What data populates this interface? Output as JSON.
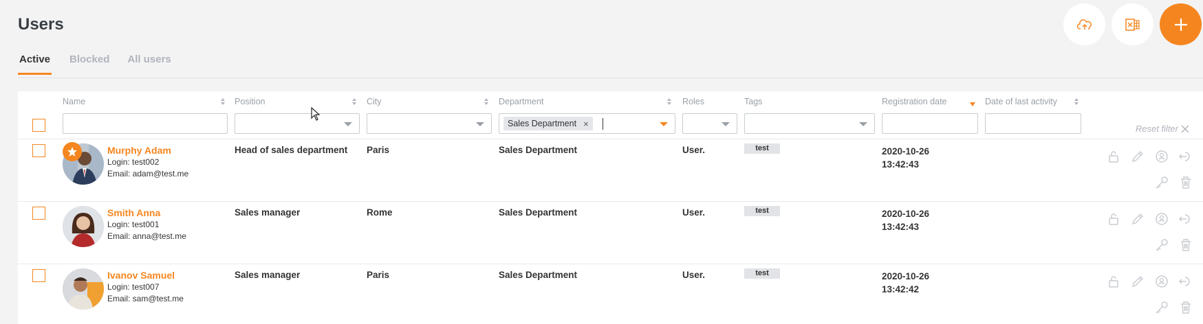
{
  "page": {
    "title": "Users"
  },
  "toolbar": {
    "upload_icon": "cloud-upload-icon",
    "excel_icon": "excel-export-icon",
    "add_icon": "plus-icon"
  },
  "tabs": [
    {
      "label": "Active",
      "active": true
    },
    {
      "label": "Blocked",
      "active": false
    },
    {
      "label": "All users",
      "active": false
    }
  ],
  "columns": {
    "name": "Name",
    "position": "Position",
    "city": "City",
    "department": "Department",
    "roles": "Roles",
    "tags": "Tags",
    "registration_date": "Registration date",
    "last_activity": "Date of last activity"
  },
  "filters": {
    "name_value": "",
    "position_value": "",
    "city_value": "",
    "department_chip": "Sales Department",
    "roles_value": "",
    "tags_value": "",
    "registration_value": "",
    "activity_value": "",
    "reset_label": "Reset filter"
  },
  "users": [
    {
      "name": "Murphy Adam",
      "login": "Login: test002",
      "email": "Email: adam@test.me",
      "position": "Head of sales department",
      "city": "Paris",
      "department": "Sales Department",
      "roles": "User.",
      "tag": "test",
      "reg_date": "2020-10-26",
      "reg_time": "13:42:43",
      "starred": true
    },
    {
      "name": "Smith Anna",
      "login": "Login: test001",
      "email": "Email: anna@test.me",
      "position": "Sales manager",
      "city": "Rome",
      "department": "Sales Department",
      "roles": "User.",
      "tag": "test",
      "reg_date": "2020-10-26",
      "reg_time": "13:42:43",
      "starred": false
    },
    {
      "name": "Ivanov Samuel",
      "login": "Login: test007",
      "email": "Email: sam@test.me",
      "position": "Sales manager",
      "city": "Paris",
      "department": "Sales Department",
      "roles": "User.",
      "tag": "test",
      "reg_date": "2020-10-26",
      "reg_time": "13:42:42",
      "starred": false
    }
  ],
  "colors": {
    "accent": "#f5861f",
    "muted": "#9aa0a6",
    "background": "#f3f3f4"
  }
}
